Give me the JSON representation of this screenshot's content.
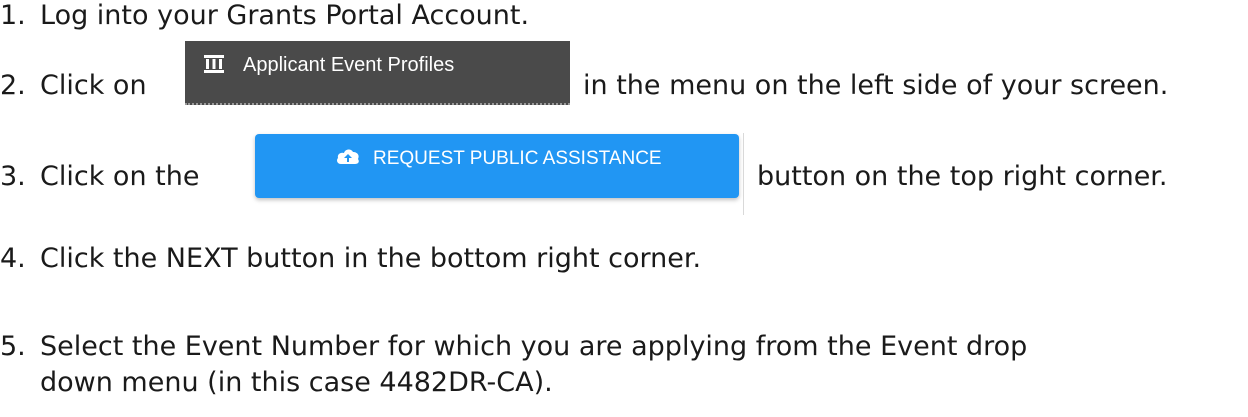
{
  "steps": [
    {
      "number": "1.",
      "text": "Log into your Grants Portal Account."
    },
    {
      "number": "2.",
      "before": "Click on",
      "after": "in the menu on the left side of your screen."
    },
    {
      "number": "3.",
      "before": "Click on the",
      "after": "button on the top right corner."
    },
    {
      "number": "4.",
      "text": "Click the NEXT button in the bottom right corner."
    },
    {
      "number": "5.",
      "line1": "Select the Event Number for which you are applying from the Event drop",
      "line2": "down menu (in this case 4482DR-CA)."
    }
  ],
  "screenshots": {
    "applicant_event_profiles": {
      "label": "Applicant Event Profiles",
      "icon": "bank-icon",
      "background": "#4a4a4a"
    },
    "request_public_assistance": {
      "label": "REQUEST PUBLIC ASSISTANCE",
      "icon": "cloud-upload-icon",
      "background": "#2196f3"
    }
  }
}
